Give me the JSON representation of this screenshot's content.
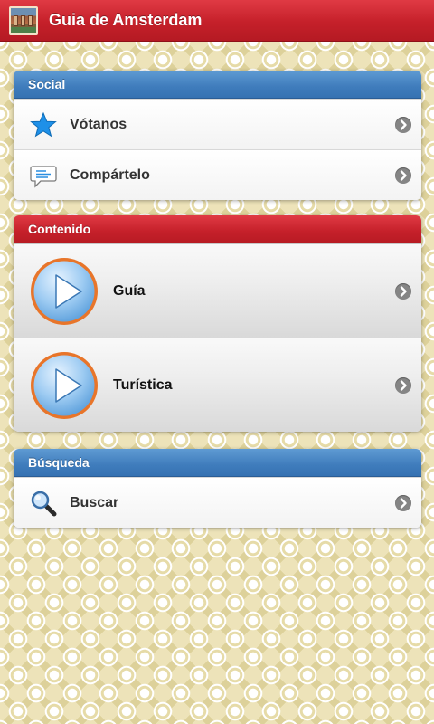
{
  "header": {
    "title": "Guia de Amsterdam",
    "icon": "amsterdam-houses-icon"
  },
  "groups": [
    {
      "title": "Social",
      "color": "#3f7cbc",
      "items": [
        {
          "label": "Vótanos",
          "icon": "star-icon"
        },
        {
          "label": "Compártelo",
          "icon": "comment-icon"
        }
      ]
    },
    {
      "title": "Contenido",
      "color": "#c5202a",
      "items": [
        {
          "label": "Guía",
          "icon": "play-icon"
        },
        {
          "label": "Turística",
          "icon": "play-icon"
        }
      ]
    },
    {
      "title": "Búsqueda",
      "color": "#3f7cbc",
      "items": [
        {
          "label": "Buscar",
          "icon": "magnifier-icon"
        }
      ]
    }
  ],
  "colors": {
    "accent_red": "#c5202a",
    "accent_blue": "#3f7cbc",
    "background": "#ede3b9",
    "play_ring": "#e8752a"
  }
}
